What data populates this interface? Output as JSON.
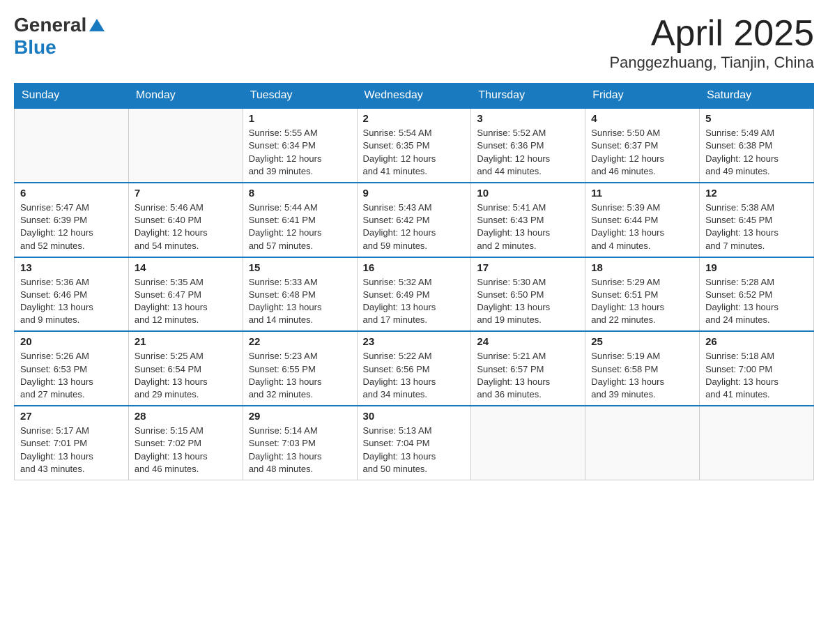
{
  "header": {
    "logo": {
      "text_general": "General",
      "text_blue": "Blue"
    },
    "title": "April 2025",
    "subtitle": "Panggezhuang, Tianjin, China"
  },
  "weekdays": [
    "Sunday",
    "Monday",
    "Tuesday",
    "Wednesday",
    "Thursday",
    "Friday",
    "Saturday"
  ],
  "weeks": [
    [
      {
        "day": "",
        "info": ""
      },
      {
        "day": "",
        "info": ""
      },
      {
        "day": "1",
        "info": "Sunrise: 5:55 AM\nSunset: 6:34 PM\nDaylight: 12 hours\nand 39 minutes."
      },
      {
        "day": "2",
        "info": "Sunrise: 5:54 AM\nSunset: 6:35 PM\nDaylight: 12 hours\nand 41 minutes."
      },
      {
        "day": "3",
        "info": "Sunrise: 5:52 AM\nSunset: 6:36 PM\nDaylight: 12 hours\nand 44 minutes."
      },
      {
        "day": "4",
        "info": "Sunrise: 5:50 AM\nSunset: 6:37 PM\nDaylight: 12 hours\nand 46 minutes."
      },
      {
        "day": "5",
        "info": "Sunrise: 5:49 AM\nSunset: 6:38 PM\nDaylight: 12 hours\nand 49 minutes."
      }
    ],
    [
      {
        "day": "6",
        "info": "Sunrise: 5:47 AM\nSunset: 6:39 PM\nDaylight: 12 hours\nand 52 minutes."
      },
      {
        "day": "7",
        "info": "Sunrise: 5:46 AM\nSunset: 6:40 PM\nDaylight: 12 hours\nand 54 minutes."
      },
      {
        "day": "8",
        "info": "Sunrise: 5:44 AM\nSunset: 6:41 PM\nDaylight: 12 hours\nand 57 minutes."
      },
      {
        "day": "9",
        "info": "Sunrise: 5:43 AM\nSunset: 6:42 PM\nDaylight: 12 hours\nand 59 minutes."
      },
      {
        "day": "10",
        "info": "Sunrise: 5:41 AM\nSunset: 6:43 PM\nDaylight: 13 hours\nand 2 minutes."
      },
      {
        "day": "11",
        "info": "Sunrise: 5:39 AM\nSunset: 6:44 PM\nDaylight: 13 hours\nand 4 minutes."
      },
      {
        "day": "12",
        "info": "Sunrise: 5:38 AM\nSunset: 6:45 PM\nDaylight: 13 hours\nand 7 minutes."
      }
    ],
    [
      {
        "day": "13",
        "info": "Sunrise: 5:36 AM\nSunset: 6:46 PM\nDaylight: 13 hours\nand 9 minutes."
      },
      {
        "day": "14",
        "info": "Sunrise: 5:35 AM\nSunset: 6:47 PM\nDaylight: 13 hours\nand 12 minutes."
      },
      {
        "day": "15",
        "info": "Sunrise: 5:33 AM\nSunset: 6:48 PM\nDaylight: 13 hours\nand 14 minutes."
      },
      {
        "day": "16",
        "info": "Sunrise: 5:32 AM\nSunset: 6:49 PM\nDaylight: 13 hours\nand 17 minutes."
      },
      {
        "day": "17",
        "info": "Sunrise: 5:30 AM\nSunset: 6:50 PM\nDaylight: 13 hours\nand 19 minutes."
      },
      {
        "day": "18",
        "info": "Sunrise: 5:29 AM\nSunset: 6:51 PM\nDaylight: 13 hours\nand 22 minutes."
      },
      {
        "day": "19",
        "info": "Sunrise: 5:28 AM\nSunset: 6:52 PM\nDaylight: 13 hours\nand 24 minutes."
      }
    ],
    [
      {
        "day": "20",
        "info": "Sunrise: 5:26 AM\nSunset: 6:53 PM\nDaylight: 13 hours\nand 27 minutes."
      },
      {
        "day": "21",
        "info": "Sunrise: 5:25 AM\nSunset: 6:54 PM\nDaylight: 13 hours\nand 29 minutes."
      },
      {
        "day": "22",
        "info": "Sunrise: 5:23 AM\nSunset: 6:55 PM\nDaylight: 13 hours\nand 32 minutes."
      },
      {
        "day": "23",
        "info": "Sunrise: 5:22 AM\nSunset: 6:56 PM\nDaylight: 13 hours\nand 34 minutes."
      },
      {
        "day": "24",
        "info": "Sunrise: 5:21 AM\nSunset: 6:57 PM\nDaylight: 13 hours\nand 36 minutes."
      },
      {
        "day": "25",
        "info": "Sunrise: 5:19 AM\nSunset: 6:58 PM\nDaylight: 13 hours\nand 39 minutes."
      },
      {
        "day": "26",
        "info": "Sunrise: 5:18 AM\nSunset: 7:00 PM\nDaylight: 13 hours\nand 41 minutes."
      }
    ],
    [
      {
        "day": "27",
        "info": "Sunrise: 5:17 AM\nSunset: 7:01 PM\nDaylight: 13 hours\nand 43 minutes."
      },
      {
        "day": "28",
        "info": "Sunrise: 5:15 AM\nSunset: 7:02 PM\nDaylight: 13 hours\nand 46 minutes."
      },
      {
        "day": "29",
        "info": "Sunrise: 5:14 AM\nSunset: 7:03 PM\nDaylight: 13 hours\nand 48 minutes."
      },
      {
        "day": "30",
        "info": "Sunrise: 5:13 AM\nSunset: 7:04 PM\nDaylight: 13 hours\nand 50 minutes."
      },
      {
        "day": "",
        "info": ""
      },
      {
        "day": "",
        "info": ""
      },
      {
        "day": "",
        "info": ""
      }
    ]
  ]
}
